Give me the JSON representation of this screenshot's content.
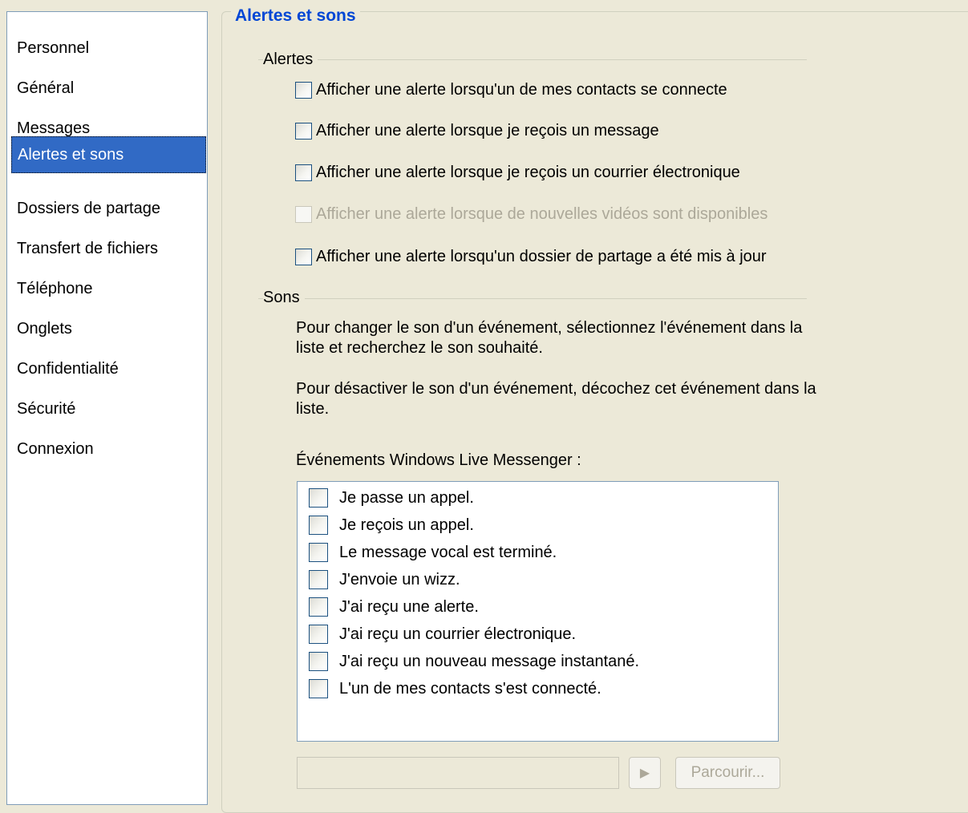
{
  "sidebar": {
    "items": [
      {
        "label": "Personnel"
      },
      {
        "label": "Général"
      },
      {
        "label": "Messages"
      },
      {
        "label": "Alertes et sons",
        "selected": true
      },
      {
        "label": "Dossiers de partage"
      },
      {
        "label": "Transfert de fichiers"
      },
      {
        "label": "Téléphone"
      },
      {
        "label": "Onglets"
      },
      {
        "label": "Confidentialité"
      },
      {
        "label": "Sécurité"
      },
      {
        "label": "Connexion"
      }
    ]
  },
  "panel": {
    "title": "Alertes et sons",
    "alerts": {
      "section_label": "Alertes",
      "options": [
        {
          "label": "Afficher une alerte lorsqu'un de mes contacts se connecte",
          "checked": false,
          "enabled": true
        },
        {
          "label": "Afficher une alerte lorsque je reçois un message",
          "checked": false,
          "enabled": true
        },
        {
          "label": "Afficher une alerte lorsque je reçois un courrier électronique",
          "checked": false,
          "enabled": true
        },
        {
          "label": "Afficher une alerte lorsque de nouvelles vidéos sont disponibles",
          "checked": false,
          "enabled": false
        },
        {
          "label": "Afficher une alerte lorsqu'un dossier de partage a été mis à jour",
          "checked": false,
          "enabled": true
        }
      ]
    },
    "sounds": {
      "section_label": "Sons",
      "instruction_change": "Pour changer le son d'un événement, sélectionnez l'événement dans la liste et recherchez le son souhaité.",
      "instruction_disable": "Pour désactiver le son d'un événement, décochez cet événement dans la liste.",
      "events_label": "Événements Windows Live Messenger :",
      "events": [
        {
          "label": "Je passe un appel.",
          "checked": false
        },
        {
          "label": "Je reçois un appel.",
          "checked": false
        },
        {
          "label": "Le message vocal est terminé.",
          "checked": false
        },
        {
          "label": "J'envoie un wizz.",
          "checked": false
        },
        {
          "label": "J'ai reçu une alerte.",
          "checked": false
        },
        {
          "label": "J'ai reçu un courrier électronique.",
          "checked": false
        },
        {
          "label": "J'ai reçu un nouveau message instantané.",
          "checked": false
        },
        {
          "label": "L'un de mes contacts s'est connecté.",
          "checked": false
        }
      ],
      "sound_path_value": "",
      "play_icon": "play-triangle-icon",
      "browse_label": "Parcourir..."
    }
  },
  "colors": {
    "selection": "#316ac5",
    "title_blue": "#0046d5",
    "dialog_bg": "#ece9d8",
    "disabled_text": "#aca899"
  }
}
